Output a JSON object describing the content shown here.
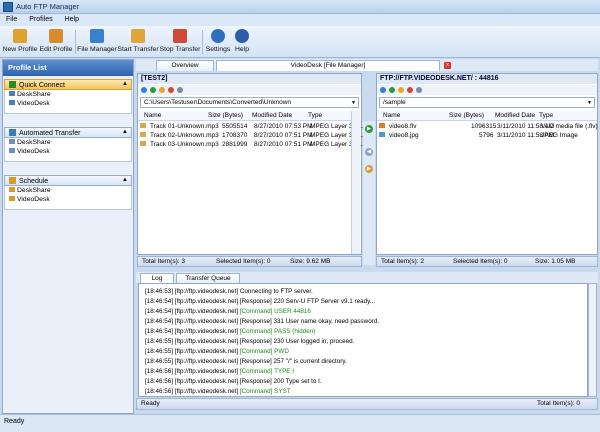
{
  "window": {
    "title": "Auto FTP Manager"
  },
  "menu": [
    "File",
    "Profiles",
    "Help"
  ],
  "toolbar": [
    {
      "label": "New Profile",
      "icon": "new-profile-icon",
      "color": "#e2a12a"
    },
    {
      "label": "Edit Profile",
      "icon": "edit-profile-icon",
      "color": "#d98a2b"
    },
    {
      "label": "File Manager",
      "icon": "file-manager-icon",
      "color": "#3b7fcf"
    },
    {
      "label": "Start Transfer",
      "icon": "start-transfer-icon",
      "color": "#e0a63c"
    },
    {
      "label": "Stop Transfer",
      "icon": "stop-transfer-icon",
      "color": "#d04a3a"
    },
    {
      "label": "Settings",
      "icon": "gear-icon",
      "color": "#2f6fbf"
    },
    {
      "label": "Help",
      "icon": "help-icon",
      "color": "#2f5ea8"
    }
  ],
  "sidebar": {
    "title": "Profile List",
    "sections": [
      {
        "title": "Quick Connect",
        "items": [
          "DeskShare",
          "VideoDesk"
        ]
      },
      {
        "title": "Automated Transfer",
        "items": [
          "DeskShare",
          "VideoDesk"
        ]
      },
      {
        "title": "Schedule",
        "items": [
          "DeskShare",
          "VideoDesk"
        ]
      }
    ]
  },
  "tabs": {
    "overview": "Overview",
    "file_manager": "VideoDesk [File Manager]",
    "close": "x"
  },
  "local": {
    "title": "[TEST2]",
    "path": "C:\\Users\\Testuser\\Documents\\Converted\\Unknown",
    "columns": [
      "Name",
      "Size (Bytes)",
      "Modified Date",
      "Type"
    ],
    "rows": [
      {
        "name": "Track 01-Unknown.mp3",
        "size": "5505514",
        "date": "8/27/2010 07:53 PM",
        "type": "MPEG Layer 3 A..."
      },
      {
        "name": "Track 02-Unknown.mp3",
        "size": "1708370",
        "date": "8/27/2010 07:51 PM",
        "type": "MPEG Layer 3 A..."
      },
      {
        "name": "Track 03-Unknown.mp3",
        "size": "2881999",
        "date": "8/27/2010 07:51 PM",
        "type": "MPEG Layer 3 A..."
      }
    ],
    "status": {
      "total": "Total Item(s): 3",
      "selected": "Selected Item(s): 0",
      "size": "Size: 9.62 MB"
    }
  },
  "remote": {
    "title": "FTP://FTP.VIDEODESK.NET/ : 44816",
    "path": "/sample",
    "columns": [
      "Name",
      "Size (Bytes)",
      "Modified Date",
      "Type"
    ],
    "rows": [
      {
        "name": "video8.flv",
        "size": "1096315",
        "date": "3/11/2010 11:58 AM",
        "type": "VLC media file (.flv)"
      },
      {
        "name": "video8.jpg",
        "size": "5796",
        "date": "3/11/2010 11:58 AM",
        "type": "JPEG Image"
      }
    ],
    "status": {
      "total": "Total Item(s): 2",
      "selected": "Selected Item(s): 0",
      "size": "Size: 1.05 MB"
    }
  },
  "log": {
    "tabs": [
      "Log",
      "Transfer Queue"
    ],
    "lines": [
      {
        "time": "[18:46:53]",
        "host": "[ftp://ftp.videodesk.net]",
        "kind": "",
        "msg": "Connecting to FTP server."
      },
      {
        "time": "[18:46:54]",
        "host": "[ftp://ftp.videodesk.net]",
        "kind": "[Response]",
        "msg": "220 Serv-U FTP Server v9.1 ready..."
      },
      {
        "time": "[18:46:54]",
        "host": "[ftp://ftp.videodesk.net]",
        "kind": "[Command]",
        "msg": "USER 44816"
      },
      {
        "time": "[18:46:54]",
        "host": "[ftp://ftp.videodesk.net]",
        "kind": "[Response]",
        "msg": "331 User name okay, need password."
      },
      {
        "time": "[18:46:54]",
        "host": "[ftp://ftp.videodesk.net]",
        "kind": "[Command]",
        "msg": "PASS (hidden)"
      },
      {
        "time": "[18:46:55]",
        "host": "[ftp://ftp.videodesk.net]",
        "kind": "[Response]",
        "msg": "230 User logged in, proceed."
      },
      {
        "time": "[18:46:55]",
        "host": "[ftp://ftp.videodesk.net]",
        "kind": "[Command]",
        "msg": "PWD"
      },
      {
        "time": "[18:46:55]",
        "host": "[ftp://ftp.videodesk.net]",
        "kind": "[Response]",
        "msg": "257 \"/\" is current directory."
      },
      {
        "time": "[18:46:56]",
        "host": "[ftp://ftp.videodesk.net]",
        "kind": "[Command]",
        "msg": "TYPE I"
      },
      {
        "time": "[18:46:56]",
        "host": "[ftp://ftp.videodesk.net]",
        "kind": "[Response]",
        "msg": "200 Type set to I."
      },
      {
        "time": "[18:46:56]",
        "host": "[ftp://ftp.videodesk.net]",
        "kind": "[Command]",
        "msg": "SYST"
      }
    ],
    "status": {
      "left": "Ready",
      "right": "Total Item(s): 0"
    }
  },
  "app_status": "Ready"
}
